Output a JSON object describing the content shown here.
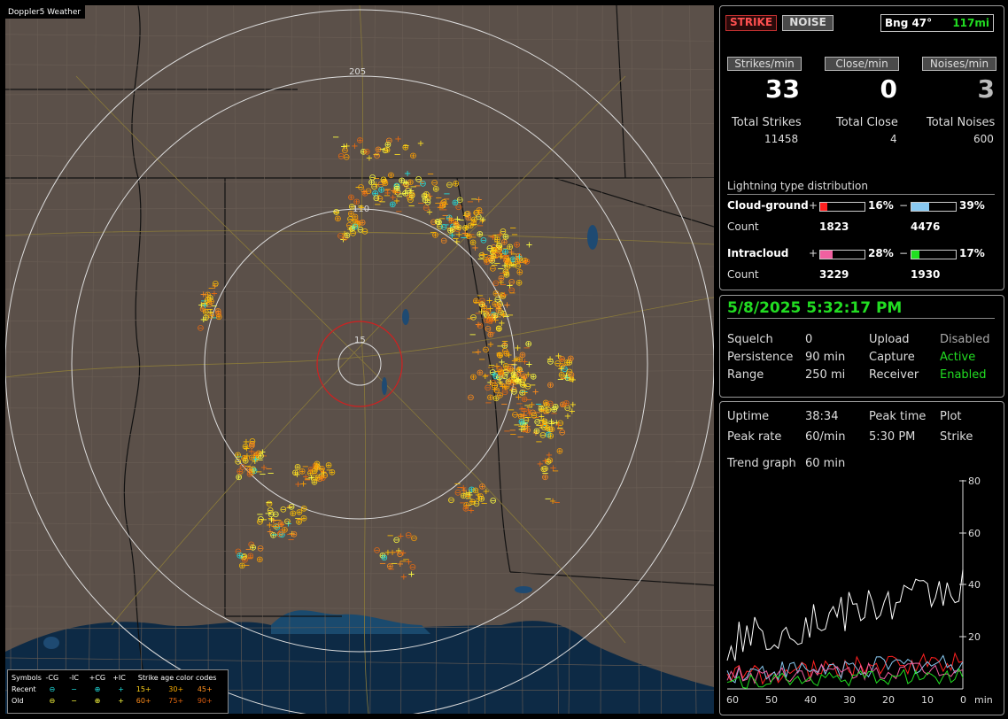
{
  "map": {
    "title": "Doppler5 Weather",
    "ring_labels": [
      "205",
      "110",
      "15"
    ],
    "legend": {
      "header": [
        "Symbols",
        "-CG",
        "-IC",
        "+CG",
        "+IC",
        "Strike age color codes"
      ],
      "recent": {
        "label": "Recent",
        "ages": [
          "15+",
          "30+",
          "45+"
        ]
      },
      "old": {
        "label": "Old",
        "ages": [
          "60+",
          "75+",
          "90+"
        ]
      }
    }
  },
  "toolbar": {
    "strike": "STRIKE",
    "noise": "NOISE",
    "bearing": "Bng 47°",
    "distance": "117mi"
  },
  "stats": {
    "strikes_label": "Strikes/min",
    "strikes_value": "33",
    "close_label": "Close/min",
    "close_value": "0",
    "noises_label": "Noises/min",
    "noises_value": "3",
    "total_strikes_label": "Total Strikes",
    "total_strikes": "11458",
    "total_close_label": "Total Close",
    "total_close": "4",
    "total_noises_label": "Total Noises",
    "total_noises": "600"
  },
  "distribution": {
    "title": "Lightning type distribution",
    "cg_label": "Cloud-ground",
    "cg_pos_pct": "16%",
    "cg_neg_pct": "39%",
    "cg_pos_frac": 0.16,
    "cg_neg_frac": 0.39,
    "count_label": "Count",
    "cg_pos_count": "1823",
    "cg_neg_count": "4476",
    "ic_label": "Intracloud",
    "ic_pos_pct": "28%",
    "ic_neg_pct": "17%",
    "ic_pos_frac": 0.28,
    "ic_neg_frac": 0.17,
    "ic_pos_count": "3229",
    "ic_neg_count": "1930",
    "plus": "+",
    "minus": "−"
  },
  "status": {
    "datetime": "5/8/2025 5:32:17 PM",
    "squelch_label": "Squelch",
    "squelch": "0",
    "upload_label": "Upload",
    "upload": "Disabled",
    "persistence_label": "Persistence",
    "persistence": "90 min",
    "capture_label": "Capture",
    "capture": "Active",
    "range_label": "Range",
    "range": "250 mi",
    "receiver_label": "Receiver",
    "receiver": "Enabled"
  },
  "trend": {
    "uptime_label": "Uptime",
    "uptime": "38:34",
    "peak_time_label": "Peak time",
    "plot_label": "Plot",
    "peak_rate_label": "Peak rate",
    "peak_rate": "60/min",
    "peak_time": "5:30 PM",
    "plot": "Strike",
    "trend_label": "Trend graph",
    "trend_value": "60 min",
    "y_ticks": [
      "80",
      "60",
      "40",
      "20"
    ],
    "x_ticks": [
      "60",
      "50",
      "40",
      "30",
      "20",
      "10",
      "0"
    ],
    "x_unit": "min"
  },
  "colors": {
    "accent_green": "#22dd22",
    "strike_red": "#e03030",
    "cg_pos": "#ff2020",
    "cg_neg": "#88c8f0",
    "ic_pos": "#f060a0",
    "ic_neg": "#20e020"
  }
}
